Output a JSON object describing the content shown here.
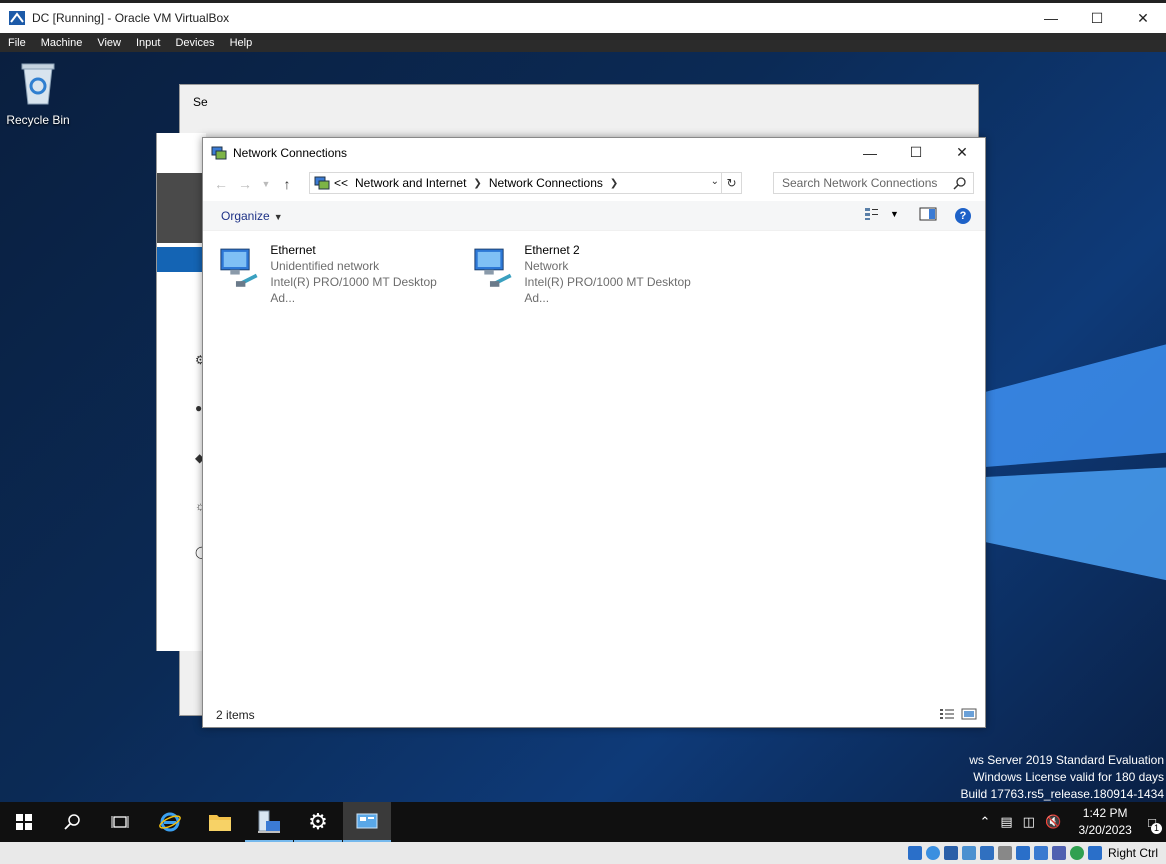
{
  "host": {
    "title": "DC [Running] - Oracle VM VirtualBox",
    "menu": [
      "File",
      "Machine",
      "View",
      "Input",
      "Devices",
      "Help"
    ],
    "right_ctrl": "Right Ctrl"
  },
  "desktop": {
    "recycle_bin_label": "Recycle Bin",
    "watermark": {
      "line1": "ws Server 2019 Standard Evaluation",
      "line2": "Windows License valid for 180 days",
      "line3": "Build 17763.rs5_release.180914-1434"
    }
  },
  "background_window": {
    "title_fragment": "Se"
  },
  "network_window": {
    "title": "Network Connections",
    "breadcrumb": {
      "overflow": "<<",
      "items": [
        "Network and Internet",
        "Network Connections"
      ]
    },
    "search_placeholder": "Search Network Connections",
    "organize_label": "Organize",
    "help_label": "?",
    "connections": [
      {
        "name": "Ethernet",
        "status": "Unidentified network",
        "adapter": "Intel(R) PRO/1000 MT Desktop Ad..."
      },
      {
        "name": "Ethernet 2",
        "status": "Network",
        "adapter": "Intel(R) PRO/1000 MT Desktop Ad..."
      }
    ],
    "status_count": "2 items"
  },
  "taskbar": {
    "time": "1:42 PM",
    "date": "3/20/2023",
    "notification_count": "1"
  }
}
